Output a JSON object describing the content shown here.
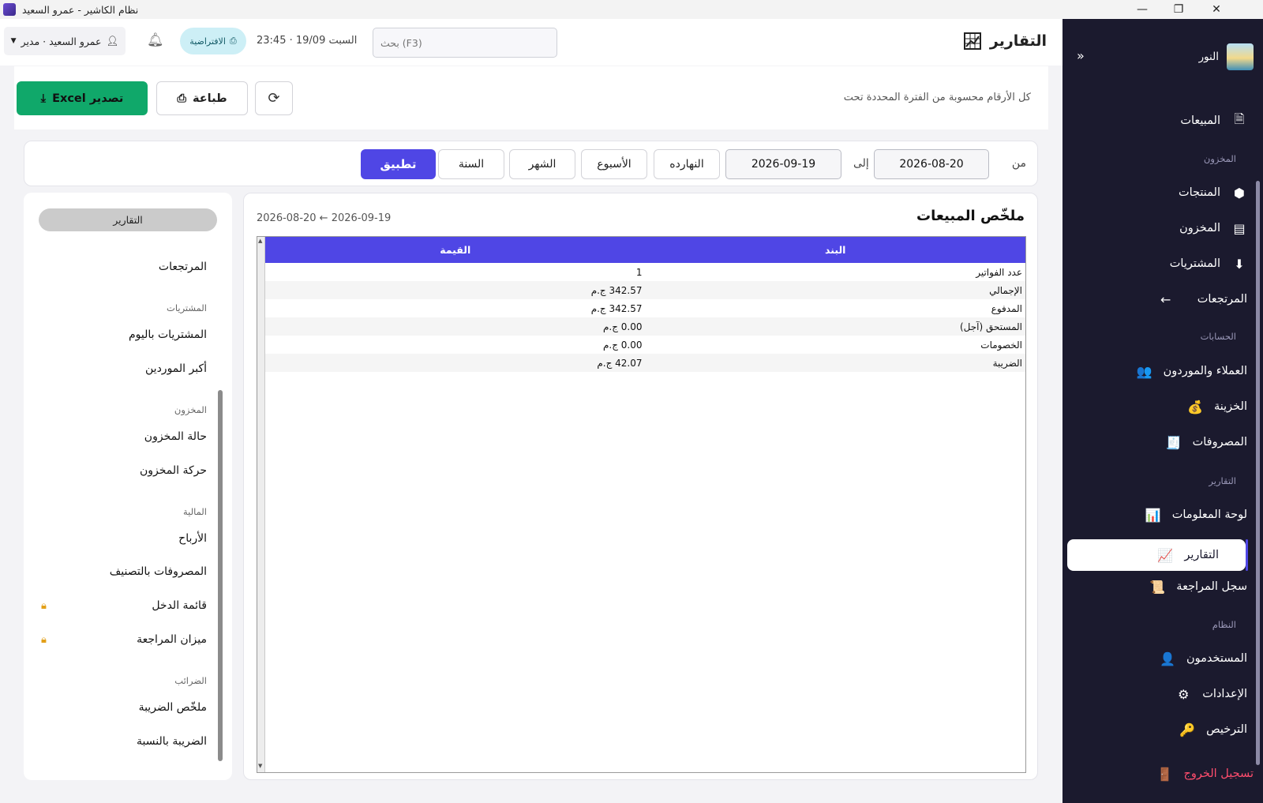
{
  "window": {
    "title": "نظام الكاشير - عمرو السعيد",
    "controls": [
      "—",
      "❐",
      "✕"
    ]
  },
  "sidebar": {
    "brand": "النور",
    "collapse_icon": "»",
    "items": [
      {
        "label": "المبيعات",
        "icon": "🗎",
        "icon_name": "document-icon"
      },
      {
        "section": "المخزون"
      },
      {
        "label": "المنتجات",
        "icon": "⬢",
        "icon_name": "box-icon"
      },
      {
        "label": "المخزون",
        "icon": "▤",
        "icon_name": "warehouse-icon"
      },
      {
        "label": "المشتريات",
        "icon": "⬇",
        "icon_name": "purchase-icon"
      },
      {
        "label": "المرتجعات",
        "icon": "←",
        "icon_name": "return-arrow-icon"
      },
      {
        "section": "الحسابات"
      },
      {
        "label": "العملاء والموردون",
        "icon": "👥",
        "icon_name": "people-icon"
      },
      {
        "label": "الخزينة",
        "icon": "💰",
        "icon_name": "money-bag-icon"
      },
      {
        "label": "المصروفات",
        "icon": "🧾",
        "icon_name": "receipt-icon"
      },
      {
        "section": "التقارير"
      },
      {
        "label": "لوحة المعلومات",
        "icon": "📊",
        "icon_name": "bar-chart-icon"
      },
      {
        "label": "التقارير",
        "icon": "📈",
        "icon_name": "report-chart-icon"
      },
      {
        "label": "سجل المراجعة",
        "icon": "📜",
        "icon_name": "audit-log-icon"
      },
      {
        "section": "النظام"
      },
      {
        "label": "المستخدمون",
        "icon": "👤",
        "icon_name": "user-icon"
      },
      {
        "label": "الإعدادات",
        "icon": "⚙",
        "icon_name": "gear-icon"
      },
      {
        "label": "الترخيص",
        "icon": "🔑",
        "icon_name": "key-icon"
      }
    ],
    "logout": {
      "label": "تسجيل الخروج",
      "icon": "🚪"
    }
  },
  "header": {
    "title": "التقارير",
    "search_placeholder": "بحث (F3)",
    "datetime": "السبت 19/09 · 23:45",
    "profile_badge": "الافتراضية",
    "user": "عمرو السعيد · مدير"
  },
  "actionbar": {
    "hint": "كل الأرقام محسوبة من الفترة المحددة تحت",
    "print_label": "طباعة",
    "export_label": "تصدير Excel"
  },
  "filters": {
    "from_label": "من",
    "from_date": "2026-08-20",
    "to_label": "إلى",
    "to_date": "2026-09-19",
    "presets": [
      "النهارده",
      "الأسبوع",
      "الشهر",
      "السنة"
    ],
    "apply_label": "تطبيق"
  },
  "report_list": {
    "header": "التقارير",
    "items": [
      {
        "label": "المرتجعات"
      },
      {
        "section": "المشتريات"
      },
      {
        "label": "المشتريات باليوم"
      },
      {
        "label": "أكبر الموردين"
      },
      {
        "section": "المخزون"
      },
      {
        "label": "حالة المخزون"
      },
      {
        "label": "حركة المخزون"
      },
      {
        "section": "المالية"
      },
      {
        "label": "الأرباح"
      },
      {
        "label": "المصروفات بالتصنيف"
      },
      {
        "label": "قائمة الدخل",
        "locked": true
      },
      {
        "label": "ميزان المراجعة",
        "locked": true
      },
      {
        "section": "الضرائب"
      },
      {
        "label": "ملخّص الضريبة"
      },
      {
        "label": "الضريبة بالنسبة"
      }
    ]
  },
  "report": {
    "title": "ملخّص المبيعات",
    "date_range": "2026-08-20 ← 2026-09-19",
    "columns": [
      "البند",
      "القيمة"
    ],
    "rows": [
      [
        "عدد الفواتير",
        "1"
      ],
      [
        "الإجمالي",
        "342.57 ج.م"
      ],
      [
        "المدفوع",
        "342.57 ج.م"
      ],
      [
        "المستحق (آجل)",
        "0.00 ج.م"
      ],
      [
        "الخصومات",
        "0.00 ج.م"
      ],
      [
        "الضريبة",
        "42.07 ج.م"
      ]
    ]
  },
  "colors": {
    "accent": "#4f46e5",
    "sidebar_bg": "#1b1a2e",
    "export_green": "#10a86a",
    "logout_red": "#ff4d6d",
    "lock_orange": "#e3a019"
  }
}
